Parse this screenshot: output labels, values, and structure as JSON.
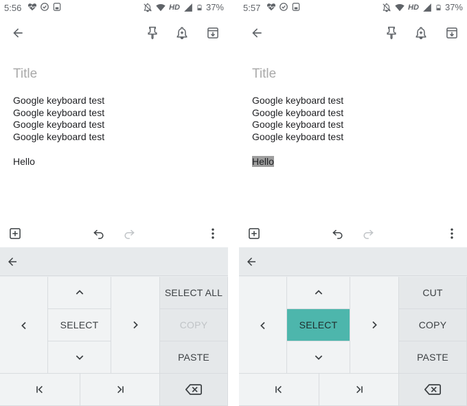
{
  "panels": [
    {
      "status": {
        "time": "5:56",
        "network": "HD",
        "battery": "37%"
      },
      "note": {
        "title_placeholder": "Title",
        "lines": [
          "Google keyboard test",
          "Google keyboard test",
          "Google keyboard test",
          "Google keyboard test"
        ],
        "last_line": "Hello"
      },
      "keyboard": {
        "select": "SELECT",
        "action1": "SELECT ALL",
        "action2": "COPY",
        "action3": "PASTE"
      }
    },
    {
      "status": {
        "time": "5:57",
        "network": "HD",
        "battery": "37%"
      },
      "note": {
        "title_placeholder": "Title",
        "lines": [
          "Google keyboard test",
          "Google keyboard test",
          "Google keyboard test",
          "Google keyboard test"
        ],
        "last_line": "Hello"
      },
      "keyboard": {
        "select": "SELECT",
        "action1": "CUT",
        "action2": "COPY",
        "action3": "PASTE"
      }
    }
  ],
  "colors": {
    "select_active": "#4db6ac",
    "text_highlight": "#9e9e9e",
    "keyboard_bg": "#eceff1"
  },
  "icons": {
    "status_left": [
      "heart-pulse-icon",
      "face-icon",
      "assistant-icon"
    ],
    "status_right": [
      "notifications-off-icon",
      "wifi-icon",
      "signal-icon",
      "battery-icon"
    ],
    "toolbar": [
      "back-arrow-icon",
      "pin-icon",
      "reminder-bell-icon",
      "archive-icon"
    ],
    "edit_toolbar": [
      "add-box-icon",
      "undo-icon",
      "redo-icon",
      "more-vert-icon"
    ],
    "keyboard": [
      "back-arrow-icon",
      "chevron-up-icon",
      "chevron-left-icon",
      "chevron-right-icon",
      "chevron-down-icon",
      "jump-start-icon",
      "jump-end-icon",
      "backspace-icon"
    ]
  }
}
